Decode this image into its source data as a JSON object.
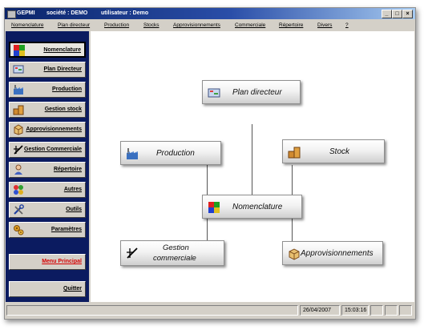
{
  "window": {
    "app_name": "GEPMI",
    "company": "société : DEMO",
    "user": "utilisateur : Demo",
    "controls": {
      "minimize": "_",
      "maximize": "□",
      "close": "×"
    }
  },
  "menu": [
    "Nomenclature",
    "Plan directeur",
    "Production",
    "Stocks",
    "Approvisionnements",
    "Commerciale",
    "Répertoire",
    "Divers",
    "?"
  ],
  "sidebar": {
    "buttons": [
      {
        "label": "Nomenclature",
        "icon": "nomenclature-icon",
        "active": true
      },
      {
        "label": "Plan Directeur",
        "icon": "plan-directeur-icon"
      },
      {
        "label": "Production",
        "icon": "factory-icon"
      },
      {
        "label": "Gestion stock",
        "icon": "stock-icon"
      },
      {
        "label": "Approvisionnements",
        "icon": "supply-icon"
      },
      {
        "label": "Gestion Commerciale",
        "icon": "commercial-icon"
      },
      {
        "label": "Répertoire",
        "icon": "directory-icon"
      },
      {
        "label": "Autres",
        "icon": "misc-icon"
      },
      {
        "label": "Outils",
        "icon": "tools-icon"
      },
      {
        "label": "Paramètres",
        "icon": "settings-icon"
      }
    ],
    "menu_principal": "Menu Principal",
    "quitter": "Quitter"
  },
  "diagram": {
    "plan_directeur": "Plan directeur",
    "production": "Production",
    "stock": "Stock",
    "nomenclature": "Nomenclature",
    "gestion_commerciale_line1": "Gestion",
    "gestion_commerciale_line2": "commerciale",
    "approvisionnements": "Approvisionnements"
  },
  "status": {
    "date": "26/04/2007",
    "time": "15:03:16"
  }
}
